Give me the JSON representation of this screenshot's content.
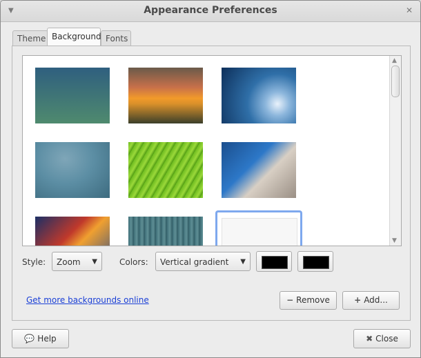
{
  "window": {
    "title": "Appearance Preferences"
  },
  "tabs": [
    {
      "label": "Theme"
    },
    {
      "label": "Background"
    },
    {
      "label": "Fonts"
    }
  ],
  "active_tab": "Background",
  "controls": {
    "style_label": "Style:",
    "style_value": "Zoom",
    "colors_label": "Colors:",
    "colors_value": "Vertical gradient",
    "primary_color": "#000000",
    "secondary_color": "#000000"
  },
  "links": {
    "more_backgrounds": "Get more backgrounds online"
  },
  "buttons": {
    "remove": "Remove",
    "add": "Add...",
    "help": "Help",
    "close": "Close"
  },
  "colors": {
    "selection": "#7ea8ee",
    "link": "#1a3fd6"
  }
}
